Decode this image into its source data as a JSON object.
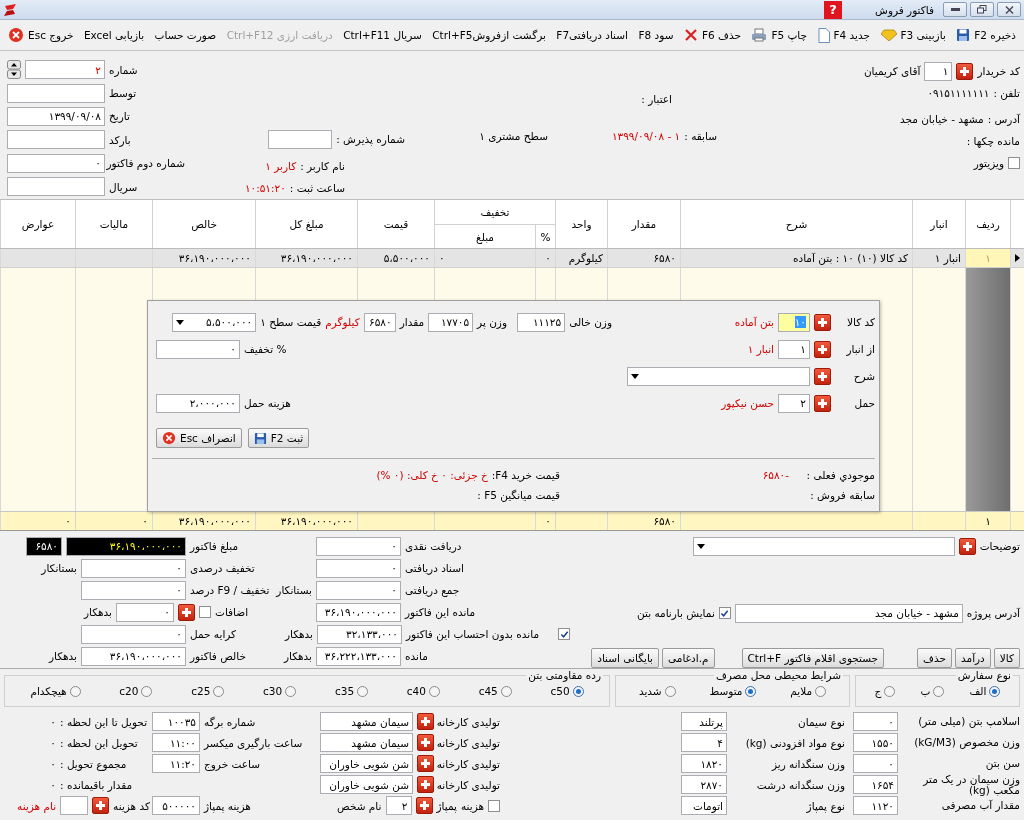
{
  "window": {
    "title": "فاکتور فروش",
    "help": "?"
  },
  "toolbar": [
    {
      "label": "ذخیره F2",
      "disabled": false
    },
    {
      "label": "بازبینی F3",
      "disabled": false
    },
    {
      "label": "جدید F4",
      "disabled": false
    },
    {
      "label": "چاپ F5",
      "disabled": false
    },
    {
      "label": "حذف F6",
      "disabled": false
    },
    {
      "label": "سود F8",
      "disabled": false
    },
    {
      "label": "اسناد دریافتیF7",
      "disabled": false
    },
    {
      "label": "برگشت ازفروشCtrl+F5",
      "disabled": false
    },
    {
      "label": "سریال Ctrl+F11",
      "disabled": false
    },
    {
      "label": "دریافت ارزی Ctrl+F12",
      "disabled": true
    },
    {
      "label": "صورت حساب",
      "disabled": false
    },
    {
      "label": "بازیابی Excel",
      "disabled": false
    },
    {
      "label": "خروج Esc",
      "disabled": false
    }
  ],
  "header": {
    "columns": [
      {
        "rows": [
          {
            "items": [
              {
                "kind": "label",
                "text": "کد خریدار"
              },
              {
                "kind": "add"
              },
              {
                "kind": "field",
                "value": "۱"
              },
              {
                "kind": "label",
                "text": "آقای کریمیان"
              }
            ]
          },
          {
            "items": [
              {
                "kind": "label",
                "text": "تلفن :"
              },
              {
                "kind": "label",
                "text": "۰۹۱۵۱۱۱۱۱۱۱"
              }
            ]
          },
          {
            "items": [
              {
                "kind": "label",
                "text": "آدرس :"
              },
              {
                "kind": "label",
                "text": "مشهد - خیابان مجد"
              }
            ]
          },
          {
            "items": [
              {
                "kind": "label",
                "text": "مانده چکها :"
              }
            ]
          },
          {
            "items": [
              {
                "kind": "check",
                "checked": false
              },
              {
                "kind": "label",
                "text": "ویزیتور"
              }
            ]
          }
        ]
      },
      {
        "rows": [
          {
            "items": [
              {
                "kind": "label",
                "text": "اعتبار :"
              }
            ]
          },
          {
            "items": [
              {
                "kind": "label",
                "text": "سابقه :"
              },
              {
                "kind": "label",
                "text": "۱ - ۱۳۹۹/۰۹/۰۸",
                "emphasis": true
              },
              {
                "kind": "label",
                "text": "سطح مشتری ۱"
              }
            ]
          }
        ]
      },
      {
        "rows": [
          {
            "items": [
              {
                "kind": "label",
                "text": "شماره پذیرش :"
              },
              {
                "kind": "field"
              }
            ]
          },
          {
            "items": [
              {
                "kind": "label",
                "text": "نام کاربر :"
              },
              {
                "kind": "label",
                "text": "کاربر ۱",
                "emphasis": true
              }
            ]
          },
          {
            "items": [
              {
                "kind": "label",
                "text": "ساعت ثبت :"
              },
              {
                "kind": "label",
                "text": "۱۰:۵۱:۲۰",
                "emphasis": true
              }
            ]
          }
        ]
      },
      {
        "rows": [
          {
            "items": [
              {
                "kind": "label",
                "text": "شماره"
              },
              {
                "kind": "field",
                "value": "۲",
                "emphasis": true
              },
              {
                "kind": "spin"
              }
            ]
          },
          {
            "items": [
              {
                "kind": "label",
                "text": "توسط"
              },
              {
                "kind": "field"
              }
            ]
          },
          {
            "items": [
              {
                "kind": "label",
                "text": "تاریخ"
              },
              {
                "kind": "field",
                "value": "۱۳۹۹/۰۹/۰۸"
              }
            ]
          },
          {
            "items": [
              {
                "kind": "label",
                "text": "بارکد"
              },
              {
                "kind": "field"
              }
            ]
          },
          {
            "items": [
              {
                "kind": "label",
                "text": "شماره دوم فاکتور"
              },
              {
                "kind": "field",
                "value": "۰"
              }
            ]
          },
          {
            "items": [
              {
                "kind": "label",
                "text": "سریال"
              },
              {
                "kind": "field"
              }
            ]
          }
        ]
      }
    ]
  },
  "table": {
    "columns": [
      {
        "header": "ردیف"
      },
      {
        "header": "انبار"
      },
      {
        "header": "شرح"
      },
      {
        "header": "مقدار"
      },
      {
        "header": "واحد"
      },
      {
        "header": "%",
        "group": "تخفیف"
      },
      {
        "header": "مبلغ",
        "in_group": true
      },
      {
        "header": "قیمت"
      },
      {
        "header": "مبلغ کل"
      },
      {
        "header": "خالص"
      },
      {
        "header": "مالیات"
      },
      {
        "header": "عوارض"
      }
    ],
    "rows": [
      {
        "selected": true,
        "cells": [
          "۱",
          "انبار ۱",
          "کد کالا (۱۰) ۱۰ : بتن آماده",
          "۶۵۸۰",
          "کیلوگرم",
          "۰",
          "۰",
          "۵،۵۰۰،۰۰۰",
          "۳۶،۱۹۰،۰۰۰،۰۰۰",
          "۳۶،۱۹۰،۰۰۰،۰۰۰",
          "",
          ""
        ]
      }
    ],
    "footer": {
      "cells": [
        "۱",
        "",
        "",
        "۶۵۸۰",
        "",
        "۰",
        "",
        "",
        "۳۶،۱۹۰،۰۰۰،۰۰۰",
        "۳۶،۱۹۰،۰۰۰،۰۰۰",
        "۰",
        "۰"
      ]
    }
  },
  "dialog": {
    "form": {
      "columns": [
        {
          "rows": [
            {
              "items": [
                {
                  "kind": "label",
                  "text": "کد کالا"
                },
                {
                  "kind": "add"
                },
                {
                  "kind": "field",
                  "value": "۱۰",
                  "focused": true
                },
                {
                  "kind": "label",
                  "text": "بتن آماده",
                  "emphasis": true
                }
              ]
            },
            {
              "items": [
                {
                  "kind": "label",
                  "text": "از انبار"
                },
                {
                  "kind": "add"
                },
                {
                  "kind": "field",
                  "value": "۱"
                },
                {
                  "kind": "label",
                  "text": "انبار ۱",
                  "emphasis": true
                }
              ]
            },
            {
              "items": [
                {
                  "kind": "label",
                  "text": "شرح"
                },
                {
                  "kind": "add"
                },
                {
                  "kind": "field",
                  "dropdown": true
                }
              ]
            },
            {
              "items": [
                {
                  "kind": "label",
                  "text": "حمل"
                },
                {
                  "kind": "add"
                },
                {
                  "kind": "field",
                  "value": "۲"
                },
                {
                  "kind": "label",
                  "text": "حسن نیکپور",
                  "emphasis": true
                }
              ]
            }
          ]
        },
        {
          "rows": [
            {
              "items": [
                {
                  "kind": "label",
                  "text": "وزن خالی"
                },
                {
                  "kind": "field",
                  "value": "۱۱۱۲۵"
                }
              ]
            }
          ]
        },
        {
          "rows": [
            {
              "items": [
                {
                  "kind": "label",
                  "text": "وزن پر"
                },
                {
                  "kind": "field",
                  "value": "۱۷۷۰۵"
                },
                {
                  "kind": "label",
                  "text": "مقدار"
                },
                {
                  "kind": "field",
                  "value": "۶۵۸۰"
                },
                {
                  "kind": "label",
                  "text": "کیلوگرم",
                  "emphasis": true
                },
                {
                  "kind": "label",
                  "text": "قیمت سطح ۱"
                },
                {
                  "kind": "field",
                  "value": "۵،۵۰۰،۰۰۰",
                  "dropdown": true
                }
              ]
            },
            {
              "items": [
                {
                  "kind": "label",
                  "text": "% تخفیف"
                },
                {
                  "kind": "field",
                  "value": "۰"
                }
              ]
            },
            {
              "items": [
                {
                  "kind": "label",
                  "text": "هزینه حمل"
                },
                {
                  "kind": "field",
                  "value": "۲،۰۰۰،۰۰۰"
                }
              ]
            },
            {
              "items": [
                {
                  "kind": "save",
                  "text": "ثبت F2"
                },
                {
                  "kind": "cancel",
                  "text": "انصراف Esc"
                }
              ]
            }
          ]
        }
      ]
    },
    "info": {
      "columns": [
        {
          "rows": [
            {
              "items": [
                {
                  "kind": "label",
                  "text": "موجودي فعلی :"
                },
                {
                  "kind": "label",
                  "text": "-۶۵۸۰",
                  "emphasis": true
                }
              ]
            },
            {
              "items": [
                {
                  "kind": "label",
                  "text": "سابقه فروش :"
                }
              ]
            }
          ]
        },
        {
          "rows": [
            {
              "items": [
                {
                  "kind": "label",
                  "text": "قیمت خرید F4:"
                },
                {
                  "kind": "label",
                  "text": "خ جزئی: ۰ خ کلی: (۰ %)",
                  "emphasis": true
                }
              ]
            },
            {
              "items": [
                {
                  "kind": "label",
                  "text": "قیمت میانگین F5 :"
                }
              ]
            }
          ]
        }
      ]
    }
  },
  "summary": {
    "columns": [
      {
        "rows": [
          {
            "items": [
              {
                "kind": "label",
                "text": "توضیحات"
              },
              {
                "kind": "add"
              },
              {
                "kind": "field",
                "dropdown": true
              }
            ]
          },
          {
            "items": [
              {
                "kind": "label",
                "text": "آدرس پروژه"
              },
              {
                "kind": "field",
                "value": "مشهد - خیابان مجد"
              },
              {
                "kind": "check",
                "checked": true
              },
              {
                "kind": "label",
                "text": "نمایش بارنامه بتن"
              }
            ]
          },
          {
            "items": [
              {
                "kind": "button",
                "text": "کالا"
              },
              {
                "kind": "button",
                "text": "درآمد"
              },
              {
                "kind": "button",
                "text": "حذف"
              },
              {
                "kind": "button",
                "text": "جستجوی اقلام فاکتور Ctrl+F"
              },
              {
                "kind": "button",
                "text": "م.ادغامی"
              },
              {
                "kind": "button",
                "text": "بایگانی اسناد"
              }
            ]
          }
        ]
      },
      {
        "rows": [
          {
            "items": [
              {
                "kind": "label",
                "text": "دریافت نقدی"
              },
              {
                "kind": "field",
                "value": "۰"
              }
            ]
          },
          {
            "items": [
              {
                "kind": "label",
                "text": "اسناد دریافتی"
              },
              {
                "kind": "field",
                "value": "۰"
              }
            ]
          },
          {
            "items": [
              {
                "kind": "label",
                "text": "جمع دریافتی"
              },
              {
                "kind": "field",
                "value": "۰"
              },
              {
                "kind": "label",
                "text": "بستانکار"
              }
            ]
          },
          {
            "items": [
              {
                "kind": "label",
                "text": "مانده این فاکتور"
              },
              {
                "kind": "field",
                "value": "۳۶،۱۹۰،۰۰۰،۰۰۰"
              }
            ]
          },
          {
            "items": [
              {
                "kind": "check",
                "checked": true
              },
              {
                "kind": "label",
                "text": "مانده بدون احتساب این فاکتور"
              },
              {
                "kind": "field",
                "value": "۳۲،۱۳۳،۰۰۰"
              },
              {
                "kind": "label",
                "text": "بدهکار"
              }
            ]
          },
          {
            "items": [
              {
                "kind": "label",
                "text": "مانده"
              },
              {
                "kind": "field",
                "value": "۳۶،۲۲۲،۱۳۳،۰۰۰"
              },
              {
                "kind": "label",
                "text": "بدهکار"
              }
            ]
          }
        ]
      },
      {
        "rows": [
          {
            "items": [
              {
                "kind": "label",
                "text": "مبلغ فاکتور"
              },
              {
                "kind": "field",
                "value": "۳۶،۱۹۰،۰۰۰،۰۰۰",
                "dark": true,
                "emphasis": true
              },
              {
                "kind": "field",
                "value": "۶۵۸۰",
                "dark": true
              }
            ]
          },
          {
            "items": [
              {
                "kind": "label",
                "text": "تخفیف درصدی"
              },
              {
                "kind": "field",
                "value": "۰"
              },
              {
                "kind": "label",
                "text": "بستانکار"
              }
            ]
          },
          {
            "items": [
              {
                "kind": "label",
                "text": "تخفیف / F9 درصد"
              },
              {
                "kind": "field",
                "value": "۰"
              }
            ]
          },
          {
            "items": [
              {
                "kind": "label",
                "text": "اضافات"
              },
              {
                "kind": "check",
                "checked": false
              },
              {
                "kind": "add"
              },
              {
                "kind": "field",
                "value": "۰"
              },
              {
                "kind": "label",
                "text": "بدهکار"
              }
            ]
          },
          {
            "items": [
              {
                "kind": "label",
                "text": "کرایه حمل"
              },
              {
                "kind": "field",
                "value": "۰"
              }
            ]
          },
          {
            "items": [
              {
                "kind": "label",
                "text": "خالص فاکتور"
              },
              {
                "kind": "field",
                "value": "۳۶،۱۹۰،۰۰۰،۰۰۰"
              },
              {
                "kind": "label",
                "text": "بدهکار"
              }
            ]
          }
        ]
      }
    ]
  },
  "order_options": [
    {
      "title": "نوع سفارش",
      "options": [
        {
          "label": "الف",
          "selected": true
        },
        {
          "label": "ب",
          "selected": false
        },
        {
          "label": "ج",
          "selected": false
        }
      ]
    },
    {
      "title": "شرایط محیطی محل مصرف",
      "options": [
        {
          "label": "ملایم",
          "selected": false
        },
        {
          "label": "متوسط",
          "selected": true
        },
        {
          "label": "شدید",
          "selected": false
        }
      ]
    },
    {
      "title": "رده مقاومتی بتن",
      "options": [
        {
          "label": "c50",
          "selected": true
        },
        {
          "label": "c45",
          "selected": false
        },
        {
          "label": "c40",
          "selected": false
        },
        {
          "label": "c35",
          "selected": false
        },
        {
          "label": "c30",
          "selected": false
        },
        {
          "label": "c25",
          "selected": false
        },
        {
          "label": "c20",
          "selected": false
        },
        {
          "label": "هیچکدام",
          "selected": false
        }
      ]
    }
  ],
  "mix": {
    "columns": [
      {
        "rows": [
          {
            "items": [
              {
                "kind": "label",
                "text": "اسلامپ بتن (میلی متر)"
              },
              {
                "kind": "field",
                "value": "۰"
              }
            ]
          },
          {
            "items": [
              {
                "kind": "label",
                "text": "وزن مخصوص (kG/M3)"
              },
              {
                "kind": "field",
                "value": "۱۵۵۰"
              }
            ]
          },
          {
            "items": [
              {
                "kind": "label",
                "text": "سن بتن"
              },
              {
                "kind": "field",
                "value": "۰"
              }
            ]
          },
          {
            "items": [
              {
                "kind": "label",
                "text": "وزن سیمان در یک متر مکعب (kg)"
              },
              {
                "kind": "field",
                "value": "۱۶۵۴"
              }
            ]
          },
          {
            "items": [
              {
                "kind": "label",
                "text": "مقدار آب مصرفی"
              },
              {
                "kind": "field",
                "value": "۱۱۲۰"
              }
            ]
          }
        ]
      },
      {
        "rows": [
          {
            "items": [
              {
                "kind": "label",
                "text": "نوع سیمان"
              },
              {
                "kind": "field",
                "value": "پرتلند"
              }
            ]
          },
          {
            "items": [
              {
                "kind": "label",
                "text": "نوع مواد افزودنی (kg)"
              },
              {
                "kind": "field",
                "value": "۴"
              }
            ]
          },
          {
            "items": [
              {
                "kind": "label",
                "text": "وزن سنگدانه ریز"
              },
              {
                "kind": "field",
                "value": "۱۸۲۰"
              }
            ]
          },
          {
            "items": [
              {
                "kind": "label",
                "text": "وزن سنگدانه درشت"
              },
              {
                "kind": "field",
                "value": "۲۸۷۰"
              }
            ]
          },
          {
            "items": [
              {
                "kind": "label",
                "text": "نوع پمپاژ"
              },
              {
                "kind": "field",
                "value": "اتومات"
              }
            ]
          }
        ]
      },
      {
        "rows": [
          {
            "items": [
              {
                "kind": "label",
                "text": "تولیدی کارخانه"
              },
              {
                "kind": "add"
              },
              {
                "kind": "field",
                "value": "سیمان مشهد"
              }
            ]
          },
          {
            "items": [
              {
                "kind": "label",
                "text": "تولیدی کارخانه"
              },
              {
                "kind": "add"
              },
              {
                "kind": "field",
                "value": "سیمان مشهد"
              }
            ]
          },
          {
            "items": [
              {
                "kind": "label",
                "text": "تولیدی کارخانه"
              },
              {
                "kind": "add"
              },
              {
                "kind": "field",
                "value": "شن شویی خاوران"
              }
            ]
          },
          {
            "items": [
              {
                "kind": "label",
                "text": "تولیدی کارخانه"
              },
              {
                "kind": "add"
              },
              {
                "kind": "field",
                "value": "شن شویی خاوران"
              }
            ]
          },
          {
            "items": [
              {
                "kind": "check",
                "checked": false
              },
              {
                "kind": "label",
                "text": "هزینه"
              },
              {
                "kind": "label",
                "text": "پمپاژ"
              },
              {
                "kind": "add"
              },
              {
                "kind": "field",
                "value": "۲"
              },
              {
                "kind": "label",
                "text": "نام شخص"
              }
            ]
          }
        ]
      },
      {
        "rows": [
          {
            "items": [
              {
                "kind": "label",
                "text": "شماره برگه"
              },
              {
                "kind": "field",
                "value": "۱۰۰۳۵"
              }
            ]
          },
          {
            "items": [
              {
                "kind": "label",
                "text": "ساعت بارگیری میکسر"
              },
              {
                "kind": "field",
                "value": "۱۱:۰۰"
              }
            ]
          },
          {
            "items": [
              {
                "kind": "label",
                "text": "ساعت خروج"
              },
              {
                "kind": "field",
                "value": "۱۱:۲۰"
              }
            ]
          },
          {
            "items": [
              {
                "kind": "label",
                "text": "هزینه پمپاژ"
              },
              {
                "kind": "field",
                "value": "۵۰۰۰۰۰"
              }
            ]
          }
        ]
      },
      {
        "rows": [
          {
            "items": [
              {
                "kind": "label",
                "text": "تحویل تا این لحظه :"
              },
              {
                "kind": "label",
                "text": "۰"
              }
            ]
          },
          {
            "items": [
              {
                "kind": "label",
                "text": "تحویل این لحظه :"
              },
              {
                "kind": "label",
                "text": "۰"
              }
            ]
          },
          {
            "items": [
              {
                "kind": "label",
                "text": "مجموع تحویل :"
              },
              {
                "kind": "label",
                "text": "۰"
              }
            ]
          },
          {
            "items": [
              {
                "kind": "label",
                "text": "مقدار باقیمانده :"
              },
              {
                "kind": "label",
                "text": "۰"
              }
            ]
          },
          {
            "items": [
              {
                "kind": "label",
                "text": "کد هزینه"
              },
              {
                "kind": "add"
              },
              {
                "kind": "field"
              },
              {
                "kind": "label",
                "text": "نام هزینه",
                "emphasis": true
              }
            ]
          }
        ]
      }
    ]
  }
}
